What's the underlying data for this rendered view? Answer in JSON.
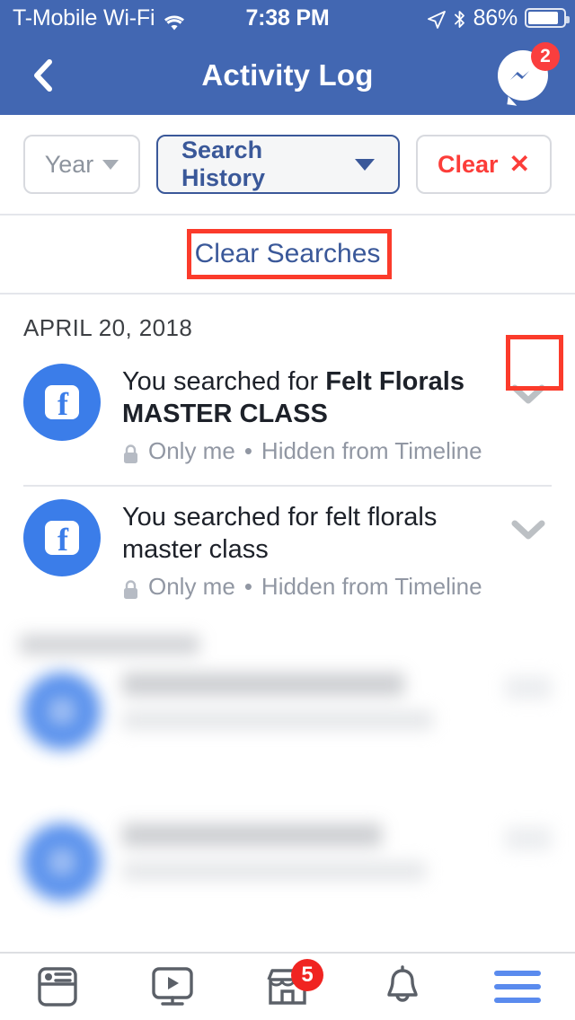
{
  "status_bar": {
    "carrier": "T-Mobile Wi-Fi",
    "wifi_icon": "wifi-icon",
    "time": "7:38 PM",
    "location_icon": "location-arrow-icon",
    "bluetooth_icon": "bluetooth-icon",
    "battery_percent": "86%",
    "battery_icon": "battery-icon"
  },
  "nav_bar": {
    "back_icon": "back-chevron-icon",
    "title": "Activity Log",
    "messenger_icon": "messenger-icon",
    "messenger_badge": "2",
    "background_color": "#4267B2"
  },
  "filters": {
    "year": {
      "label": "Year",
      "icon": "chevron-down-outline-icon"
    },
    "search_history": {
      "label": "Search History",
      "icon": "chevron-down-solid-icon",
      "active": true,
      "color": "#3A5899"
    },
    "clear": {
      "label": "Clear",
      "icon": "close-x-icon",
      "color": "#FC3D39"
    }
  },
  "clear_searches": {
    "label": "Clear Searches",
    "color": "#3A5899"
  },
  "highlights": {
    "color": "#FB3B2B"
  },
  "feed": {
    "date_header": "APRIL 20, 2018",
    "items": [
      {
        "avatar_icon": "facebook-avatar-icon",
        "text_prefix": "You searched for ",
        "text_query": "Felt Florals MASTER CLASS",
        "privacy_icon": "lock-icon",
        "privacy": "Only me",
        "separator": "•",
        "visibility": "Hidden from Timeline",
        "chevron_icon": "chevron-down-icon",
        "highlighted": true
      },
      {
        "avatar_icon": "facebook-avatar-icon",
        "text_prefix": "You searched for ",
        "text_query": "felt florals master class",
        "privacy_icon": "lock-icon",
        "privacy": "Only me",
        "separator": "•",
        "visibility": "Hidden from Timeline",
        "chevron_icon": "chevron-down-icon",
        "highlighted": false
      }
    ]
  },
  "tab_bar": {
    "tabs": [
      {
        "name": "news-feed",
        "icon": "news-feed-icon",
        "badge": null
      },
      {
        "name": "watch",
        "icon": "watch-video-icon",
        "badge": null
      },
      {
        "name": "marketplace",
        "icon": "marketplace-store-icon",
        "badge": "5"
      },
      {
        "name": "notifications",
        "icon": "bell-icon",
        "badge": null
      },
      {
        "name": "menu",
        "icon": "hamburger-menu-icon",
        "badge": null
      }
    ]
  }
}
